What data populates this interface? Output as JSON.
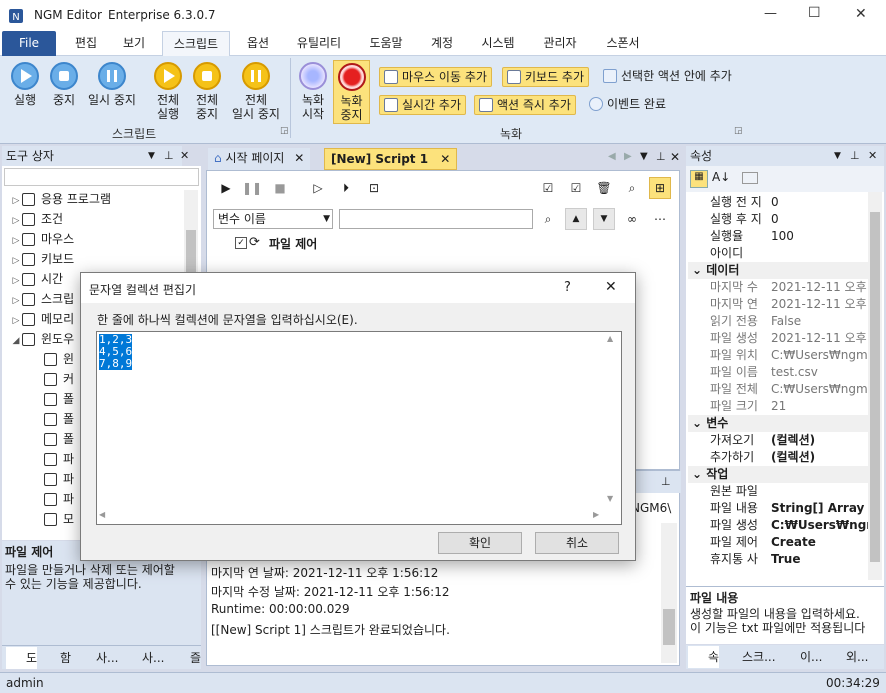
{
  "window": {
    "app_name": "NGM Editor",
    "edition": "Enterprise 6.3.0.7",
    "min_glyph": "—",
    "max_glyph": "☐",
    "close_glyph": "✕"
  },
  "menu": {
    "file": "File",
    "items": [
      "편집",
      "보기",
      "스크립트",
      "옵션",
      "유틸리티",
      "도움말",
      "계정",
      "시스템",
      "관리자",
      "스폰서"
    ]
  },
  "ribbon": {
    "script_group": {
      "label": "스크립트",
      "run": "실행",
      "stop": "중지",
      "pause": "일시 중지",
      "run_all_1": "전체",
      "run_all_2": "실행",
      "stop_all_1": "전체",
      "stop_all_2": "중지",
      "pause_all_1": "전체",
      "pause_all_2": "일시 중지"
    },
    "record_group": {
      "label": "녹화",
      "record_start_1": "녹화",
      "record_start_2": "시작",
      "record_stop_1": "녹화",
      "record_stop_2": "중지",
      "mouse_move": "마우스 이동 추가",
      "keyboard": "키보드 추가",
      "add_in_selected": "선택한 액션 안에 추가",
      "realtime": "실시간 추가",
      "action_instant": "액션 즉시 추가",
      "event_done": "이벤트 완료"
    }
  },
  "toolbox": {
    "title": "도구 상자",
    "items": [
      {
        "label": "응용 프로그램",
        "expanded": false
      },
      {
        "label": "조건",
        "expanded": false
      },
      {
        "label": "마우스",
        "expanded": false
      },
      {
        "label": "키보드",
        "expanded": false
      },
      {
        "label": "시간",
        "expanded": false
      },
      {
        "label": "스크립",
        "expanded": false
      },
      {
        "label": "메모리",
        "expanded": false
      },
      {
        "label": "윈도우",
        "expanded": true
      }
    ],
    "sub_items": [
      "윈",
      "커",
      "폴",
      "폴",
      "폴",
      "파",
      "파",
      "파",
      "모"
    ],
    "desc_title": "파일 제어",
    "desc_text_1": "파일을 만들거나 삭제 또는 제어할",
    "desc_text_2": "수 있는 기능을 제공합니다.",
    "bottom_tabs": [
      "도",
      "함",
      "사...",
      "사...",
      "즐"
    ]
  },
  "doc_tabs": {
    "start": "시작 페이지",
    "script": "[New] Script 1"
  },
  "editor": {
    "var_select": "변수 이름",
    "action_label": "파일 제어",
    "path_hint": "NGM6\\"
  },
  "log": {
    "lines": [
      "마지막 연 날짜: 2021-12-11 오후 1:56:12",
      "마지막 수정 날짜: 2021-12-11 오후 1:56:12",
      "Runtime: 00:00:00.029",
      "[[New] Script 1] 스크립트가 완료되었습니다."
    ]
  },
  "properties": {
    "title": "속성",
    "rows_top": [
      {
        "n": "실행 전 지",
        "v": "0"
      },
      {
        "n": "실행 후 지",
        "v": "0"
      },
      {
        "n": "실행율",
        "v": "100"
      },
      {
        "n": "아이디",
        "v": ""
      }
    ],
    "cat_data": "데이터",
    "rows_data": [
      {
        "n": "마지막 수",
        "v": "2021-12-11 오후 1"
      },
      {
        "n": "마지막 연",
        "v": "2021-12-11 오후 1"
      },
      {
        "n": "읽기 전용",
        "v": "False"
      },
      {
        "n": "파일 생성",
        "v": "2021-12-11 오후 1"
      },
      {
        "n": "파일 위치",
        "v": "C:₩Users₩ngma"
      },
      {
        "n": "파일 이름",
        "v": "test.csv"
      },
      {
        "n": "파일 전체",
        "v": "C:₩Users₩ngma"
      },
      {
        "n": "파일 크기",
        "v": "21"
      }
    ],
    "cat_var": "변수",
    "rows_var": [
      {
        "n": "가져오기",
        "v": "(컬렉션)"
      },
      {
        "n": "추가하기",
        "v": "(컬렉션)"
      }
    ],
    "cat_job": "작업",
    "rows_job": [
      {
        "n": "원본 파일",
        "v": ""
      },
      {
        "n": "파일 내용",
        "v": "String[] Array"
      },
      {
        "n": "파일 생성",
        "v": "C:₩Users₩ngm"
      },
      {
        "n": "파일 제어",
        "v": "Create"
      },
      {
        "n": "휴지통 사",
        "v": "True"
      }
    ],
    "desc_title": "파일 내용",
    "desc_text_1": "생성할 파일의 내용을 입력하세요.",
    "desc_text_2": "이 기능은 txt 파일에만 적용됩니다",
    "bottom_tabs": [
      "속",
      "스크...",
      "이...",
      "외..."
    ]
  },
  "dialog": {
    "title": "문자열 컬렉션 편집기",
    "help": "?",
    "close": "✕",
    "instruction": "한 줄에 하나씩 컬렉션에 문자열을 입력하십시오(E).",
    "lines": [
      "1,2,3",
      "4,5,6",
      "7,8,9"
    ],
    "ok": "확인",
    "cancel": "취소"
  },
  "status": {
    "user": "admin",
    "time": "00:34:29"
  },
  "colors": {
    "accent": "#2b579a",
    "ribbon_bg": "#dfe9f5",
    "highlight_yellow": "#fce27c",
    "selection": "#0078d7"
  }
}
